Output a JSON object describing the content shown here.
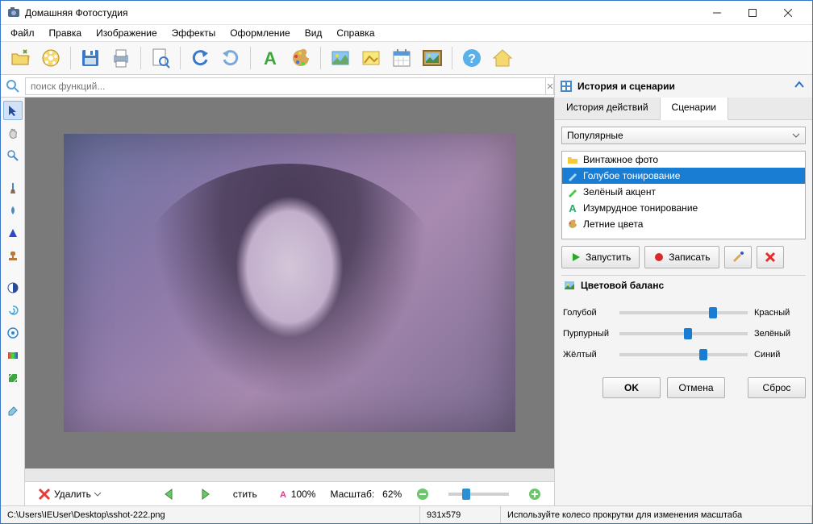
{
  "window": {
    "title": "Домашняя Фотостудия"
  },
  "menu": [
    "Файл",
    "Правка",
    "Изображение",
    "Эффекты",
    "Оформление",
    "Вид",
    "Справка"
  ],
  "toolbar_icons": [
    "open",
    "film",
    "save",
    "print",
    "preview",
    "undo",
    "redo",
    "text",
    "palette",
    "image",
    "morph",
    "calendar",
    "frame",
    "help",
    "home"
  ],
  "search": {
    "placeholder": "поиск функций..."
  },
  "left_tools": [
    "arrow",
    "hand",
    "zoom",
    "brush",
    "fill",
    "cone",
    "retouch",
    "contrast",
    "swirl",
    "target",
    "gradient",
    "crop",
    "eraser"
  ],
  "footer": {
    "delete": "Удалить",
    "fit": "стить",
    "scale_label": "100%",
    "zoom_label": "Масштаб:",
    "zoom_value": "62%"
  },
  "right": {
    "panel_title": "История и сценарии",
    "tabs": [
      "История действий",
      "Сценарии"
    ],
    "active_tab": 1,
    "combo": "Популярные",
    "scenarios": [
      {
        "icon": "folder",
        "label": "Винтажное фото",
        "selected": false
      },
      {
        "icon": "brush-blue",
        "label": "Голубое тонирование",
        "selected": true
      },
      {
        "icon": "pencil-green",
        "label": "Зелёный акцент",
        "selected": false
      },
      {
        "icon": "a-green",
        "label": "Изумрудное тонирование",
        "selected": false
      },
      {
        "icon": "palette",
        "label": "Летние цвета",
        "selected": false
      }
    ],
    "actions": {
      "run": "Запустить",
      "record": "Записать"
    },
    "balance_title": "Цветовой баланс",
    "balance": [
      {
        "left": "Голубой",
        "right": "Красный",
        "pos": 70
      },
      {
        "left": "Пурпурный",
        "right": "Зелёный",
        "pos": 50
      },
      {
        "left": "Жёлтый",
        "right": "Синий",
        "pos": 62
      }
    ],
    "buttons": {
      "ok": "OK",
      "cancel": "Отмена",
      "reset": "Сброс"
    }
  },
  "status": {
    "path": "C:\\Users\\IEUser\\Desktop\\sshot-222.png",
    "size": "931x579",
    "hint": "Используйте колесо прокрутки для изменения масштаба"
  }
}
